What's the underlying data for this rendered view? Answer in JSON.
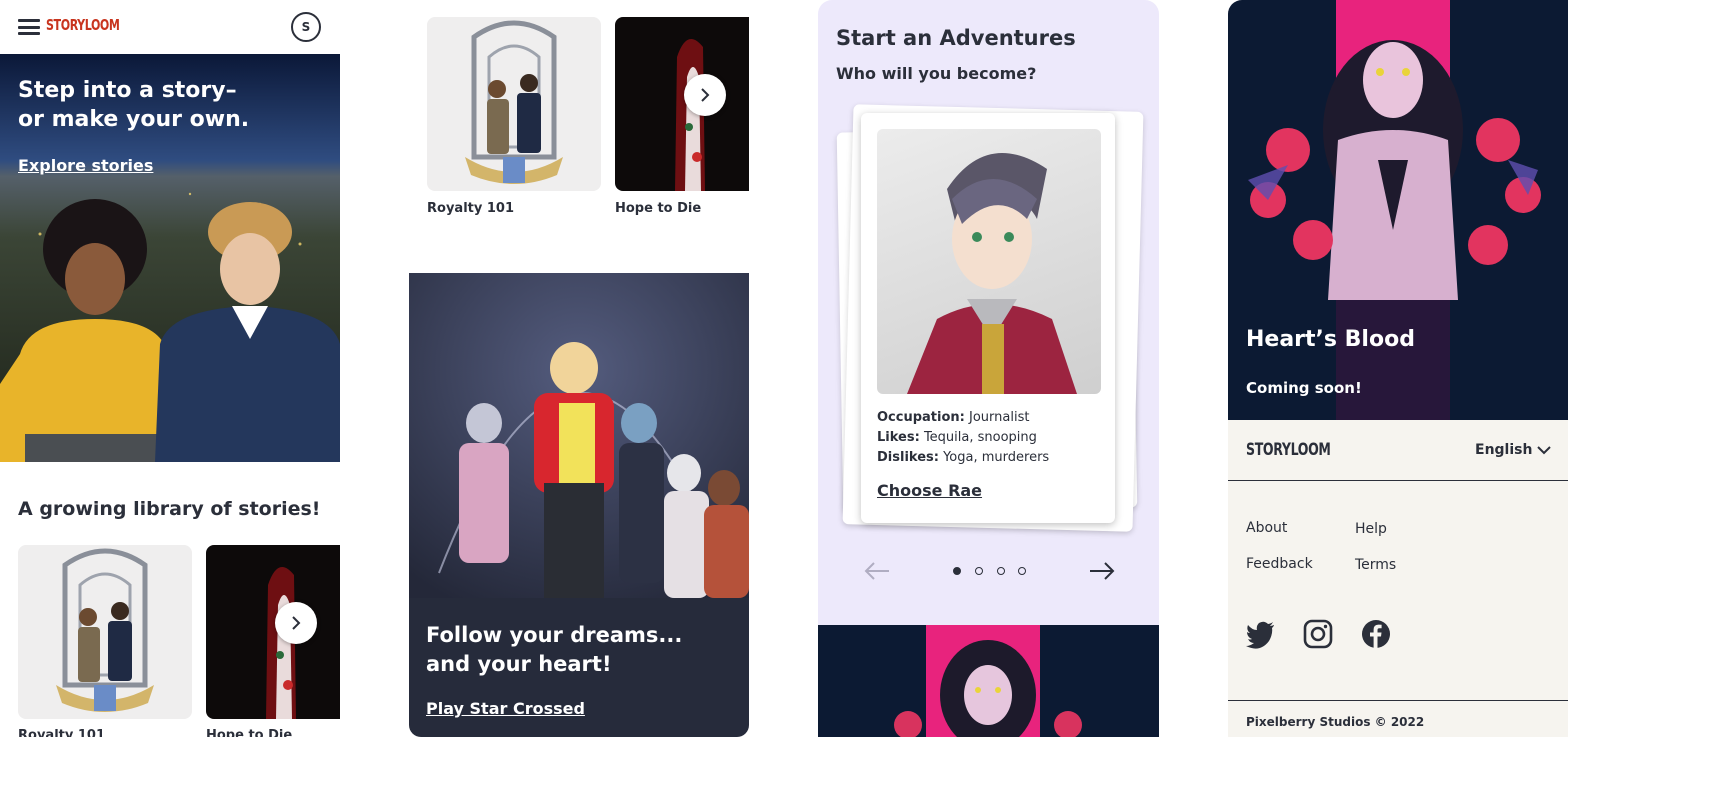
{
  "header": {
    "brand": "STORYLOOM",
    "avatar_initial": "S"
  },
  "hero": {
    "headline_line1": "Step into a story–",
    "headline_line2": "or make your own.",
    "cta": "Explore stories"
  },
  "library": {
    "title": "A growing library of stories!",
    "stories": [
      {
        "title": "Royalty 101"
      },
      {
        "title": "Hope to Die"
      }
    ]
  },
  "star_crossed": {
    "headline_line1": "Follow your dreams...",
    "headline_line2": "and your heart!",
    "cta": "Play Star Crossed"
  },
  "adventure": {
    "title": "Start an Adventures",
    "subtitle": "Who will you become?",
    "character": {
      "occupation_label": "Occupation:",
      "occupation": "Journalist",
      "likes_label": "Likes:",
      "likes": "Tequila, snooping",
      "dislikes_label": "Dislikes:",
      "dislikes": "Yoga, murderers",
      "cta": "Choose Rae"
    },
    "pagination": {
      "total": 4,
      "current": 1
    }
  },
  "feature": {
    "title": "Heart’s Blood",
    "subtitle": "Coming soon!"
  },
  "footer": {
    "brand": "STORYLOOM",
    "language": "English",
    "links": [
      "About",
      "Help",
      "Feedback",
      "Terms"
    ],
    "social": [
      "twitter-icon",
      "instagram-icon",
      "facebook-icon"
    ],
    "copyright": "Pixelberry Studios © 2022"
  },
  "colors": {
    "brand_red": "#c8341e",
    "ink": "#2b2f3a",
    "lavender": "#ede9fb",
    "navy": "#0c1a33",
    "pink": "#e8237d"
  }
}
